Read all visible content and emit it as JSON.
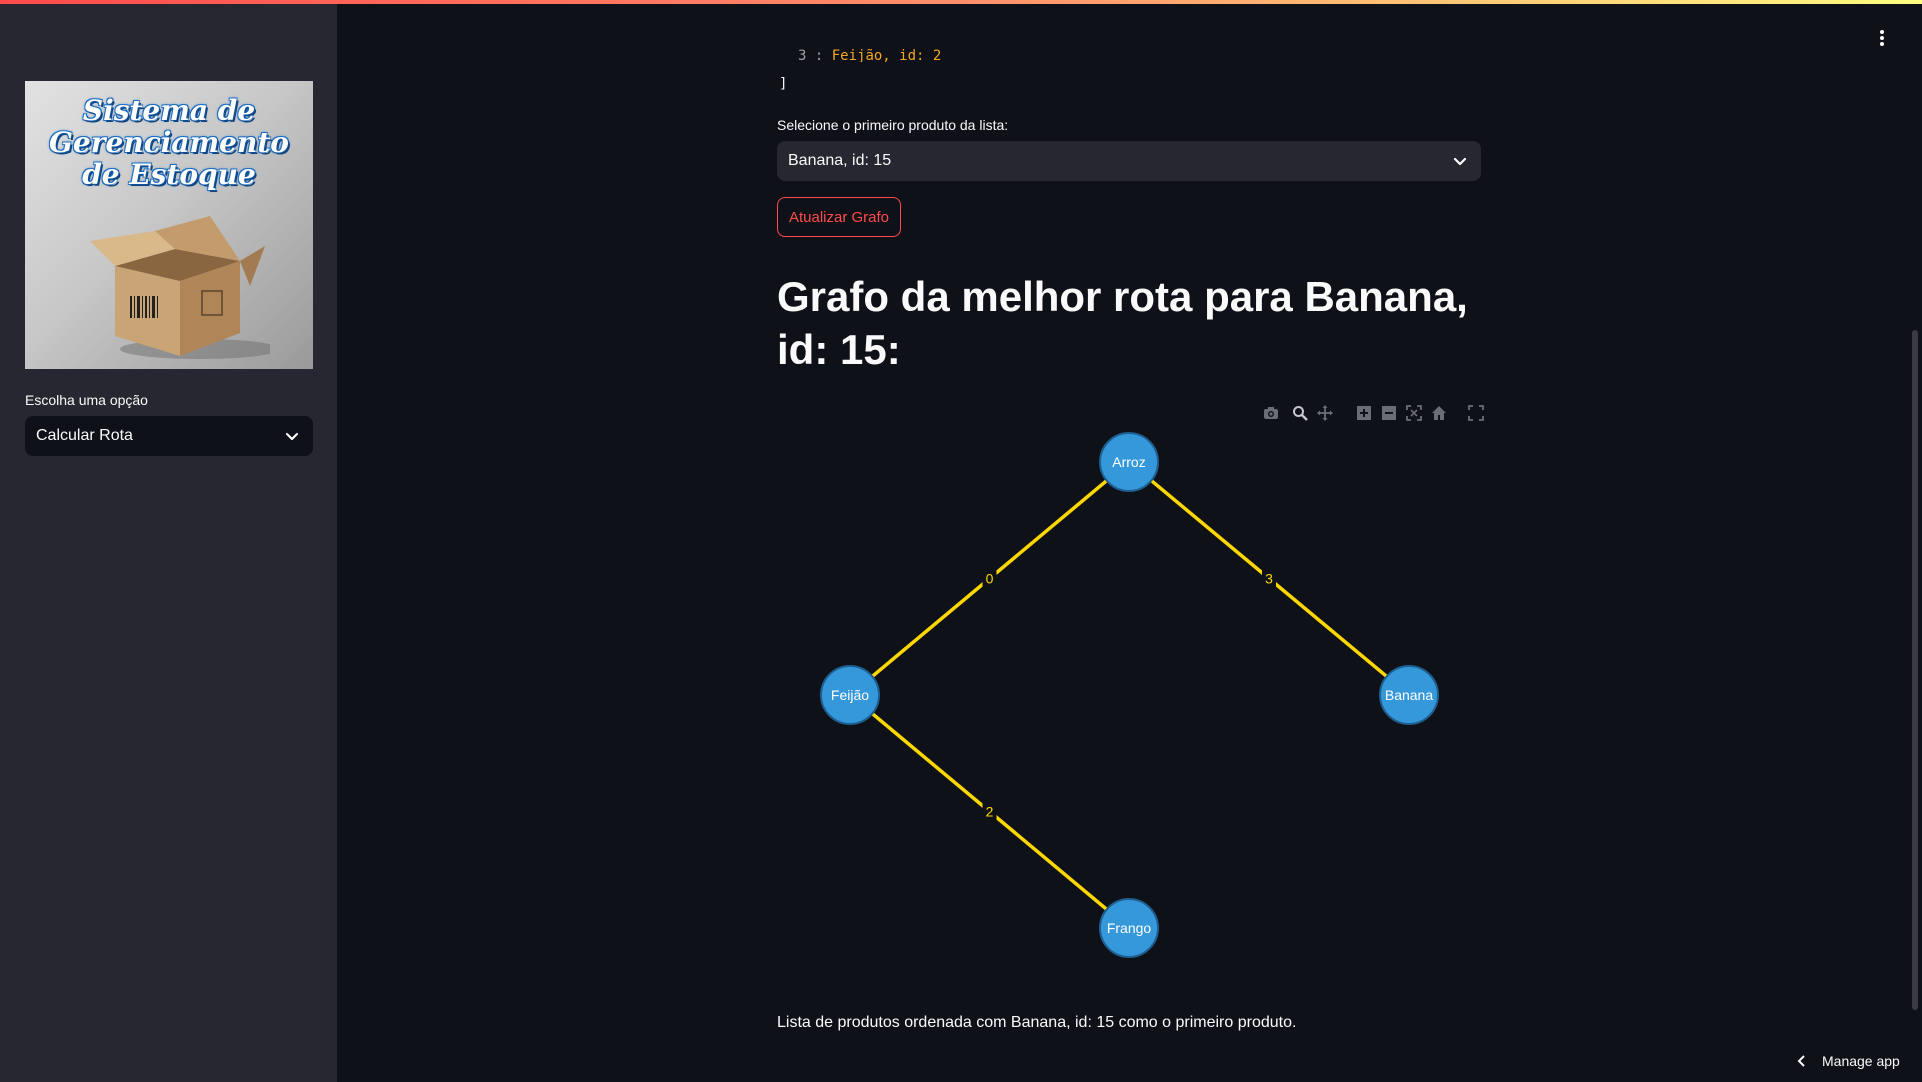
{
  "sidebar": {
    "logo_title_line1": "Sistema de",
    "logo_title_line2": "Gerenciamento",
    "logo_title_line3": "de Estoque",
    "option_label": "Escolha uma opção",
    "option_value": "Calcular Rota"
  },
  "code_block": {
    "partial_line_prefix": "3 :",
    "partial_line_value": "Feijão, id: 2",
    "closing_bracket": "]"
  },
  "main": {
    "select_label": "Selecione o primeiro produto da lista:",
    "select_value": "Banana, id: 15",
    "update_button": "Atualizar Grafo",
    "heading": "Grafo da melhor rota para Banana, id: 15:",
    "footer_text": "Lista de produtos ordenada com Banana, id: 15 como o primeiro produto."
  },
  "graph": {
    "nodes": [
      "Arroz",
      "Feijão",
      "Banana",
      "Frango"
    ],
    "edges": [
      {
        "from": "Feijão",
        "to": "Arroz",
        "label": "0"
      },
      {
        "from": "Arroz",
        "to": "Banana",
        "label": "3"
      },
      {
        "from": "Feijão",
        "to": "Frango",
        "label": "2"
      }
    ],
    "node_color": "#3498db",
    "edge_color": "#ffd700",
    "modebar_icons": [
      "camera-icon",
      "zoom-icon",
      "pan-icon",
      "zoom-in-icon",
      "zoom-out-icon",
      "autoscale-icon",
      "home-icon",
      "fullscreen-icon"
    ]
  },
  "app": {
    "manage_label": "Manage app",
    "accent_color": "#ff4b4b"
  }
}
